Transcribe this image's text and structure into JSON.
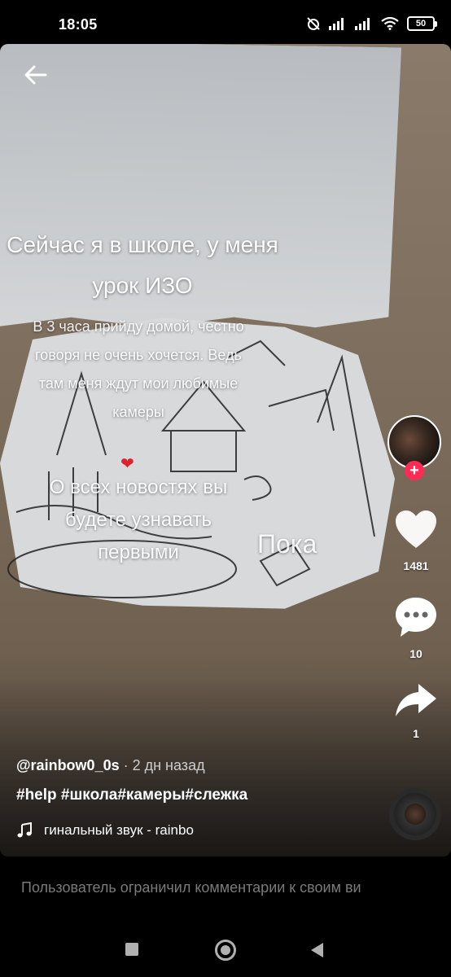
{
  "status_bar": {
    "time": "18:05",
    "battery": "50",
    "icons": [
      "alarm-off-icon",
      "signal-icon",
      "signal-icon",
      "wifi-icon",
      "battery-icon"
    ]
  },
  "video": {
    "headline": "Сейчас я в школе, у меня урок ИЗО",
    "subtext": "В 3 часа прийду домой, честно говоря не очень хочется. Ведь там меня ждут мои любимые камеры",
    "subtext2": "О всех новостях вы будете узнавать первыми",
    "bye": "Пока",
    "heart": "❤"
  },
  "rail": {
    "likes": "1481",
    "comments": "10",
    "shares": "1"
  },
  "post": {
    "author": "@rainbow0_0s",
    "time": " · 2 дн назад",
    "hashtags": "#help #школа#камеры#слежка",
    "sound": "гинальный звук - rainbo"
  },
  "comments_notice": "Пользователь ограничил комментарии к своим ви",
  "colors": {
    "accent": "#fe2c55",
    "background": "#000000",
    "muted_text": "#7a7a7a"
  }
}
